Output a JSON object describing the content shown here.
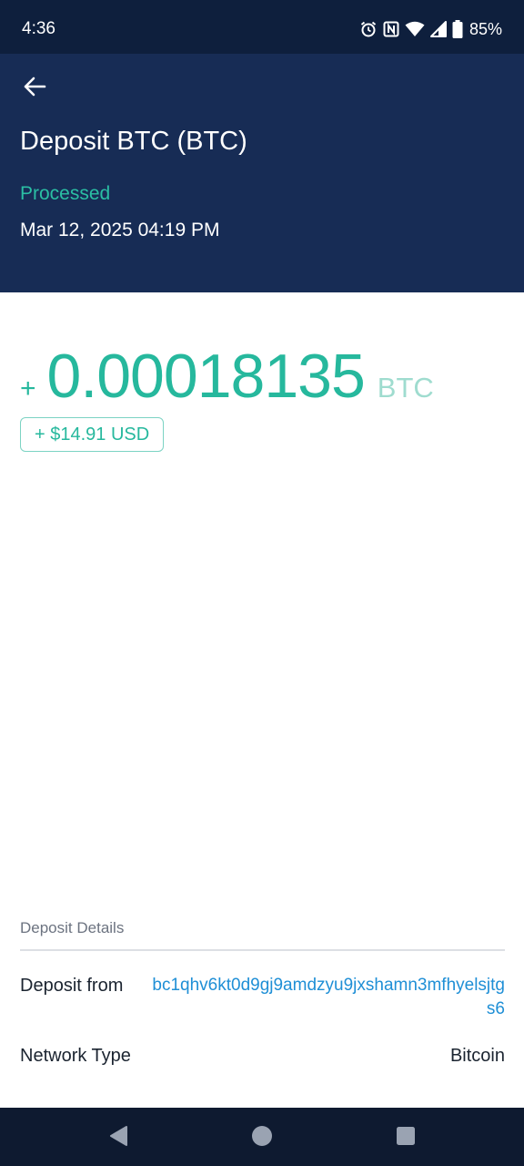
{
  "status_bar": {
    "time": "4:36",
    "battery": "85%",
    "icons": [
      "alarm-icon",
      "nfc-icon",
      "wifi-icon",
      "signal-icon",
      "battery-icon"
    ]
  },
  "header": {
    "back_icon": "arrow-left-icon",
    "title": "Deposit BTC (BTC)",
    "status": "Processed",
    "date": "Mar 12, 2025 04:19 PM"
  },
  "amount": {
    "sign": "+",
    "value": "0.00018135",
    "unit": "BTC",
    "usd": "+ $14.91 USD"
  },
  "details": {
    "heading": "Deposit Details",
    "rows": [
      {
        "label": "Deposit from",
        "value": "bc1qhv6kt0d9gj9amdzyu9jxshamn3mfhyelsjtgs6"
      },
      {
        "label": "Network Type",
        "value": "Bitcoin"
      }
    ]
  },
  "nav_bar": {
    "buttons": [
      "back-triangle-icon",
      "home-circle-icon",
      "recents-square-icon"
    ]
  },
  "colors": {
    "header_bg": "#172c55",
    "status_bar_bg": "#0e1f3d",
    "accent_green": "#26b89d",
    "link_blue": "#1f8fd6"
  }
}
